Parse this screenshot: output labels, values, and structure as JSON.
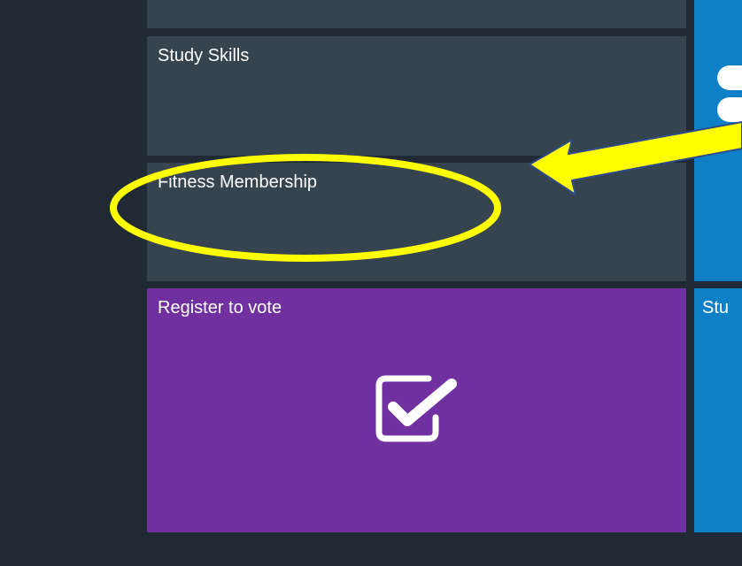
{
  "tiles": {
    "study_skills": {
      "label": "Study Skills"
    },
    "fitness_membership": {
      "label": "Fitness Membership"
    },
    "register_to_vote": {
      "label": "Register to vote",
      "icon": "checkbox-checked-icon"
    },
    "blue_bottom": {
      "label": "Stu"
    },
    "blue_top": {
      "icon": "partial-glyph-icon"
    }
  },
  "annotation": {
    "ellipse_color": "#ffff00",
    "arrow_color": "#ffff00",
    "arrow_outline": "#2e4a8a"
  },
  "colors": {
    "background": "#1f2a35",
    "tile_gray": "#36444f",
    "tile_purple": "#7030a0",
    "tile_blue": "#0e80c8"
  }
}
